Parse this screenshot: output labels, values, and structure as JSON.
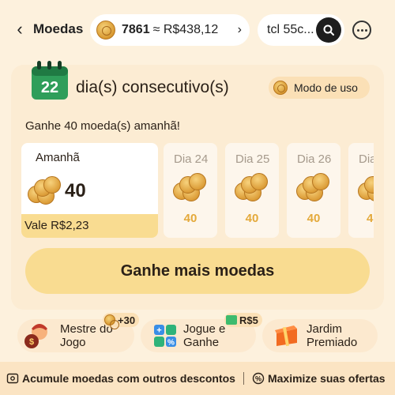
{
  "header": {
    "back_icon": "chevron-left-icon",
    "title": "Moedas",
    "coin_count": "7861",
    "coin_value": "≈ R$438,12",
    "search_text": "tcl 55c...",
    "search_icon": "search-icon",
    "more_icon": "more-icon"
  },
  "streak": {
    "day_number": "22",
    "title": "dia(s) consecutivo(s)",
    "usage_label": "Modo de uso",
    "tomorrow_text": "Ganhe 40 moeda(s) amanhã!"
  },
  "days": {
    "tomorrow": {
      "label": "Amanhã",
      "amount": "40",
      "value": "Vale R$2,23"
    },
    "upcoming": [
      {
        "label": "Dia 24",
        "amount": "40"
      },
      {
        "label": "Dia 25",
        "amount": "40"
      },
      {
        "label": "Dia 26",
        "amount": "40"
      },
      {
        "label": "Dia",
        "amount": "4"
      }
    ]
  },
  "cta_label": "Ganhe mais moedas",
  "tasks": [
    {
      "label_line1": "Mestre do",
      "label_line2": "Jogo",
      "badge": "+30"
    },
    {
      "label_line1": "Jogue e",
      "label_line2": "Ganhe",
      "badge": "R$5"
    },
    {
      "label_line1": "Jardim",
      "label_line2": "Premiado"
    }
  ],
  "footer": {
    "left": "Acumule moedas com outros descontos",
    "right": "Maximize suas ofertas"
  },
  "colors": {
    "background": "#fdf1dd",
    "accent": "#f9dc91",
    "coin": "#dc9d38",
    "calendar_green": "#2f9e5a"
  }
}
